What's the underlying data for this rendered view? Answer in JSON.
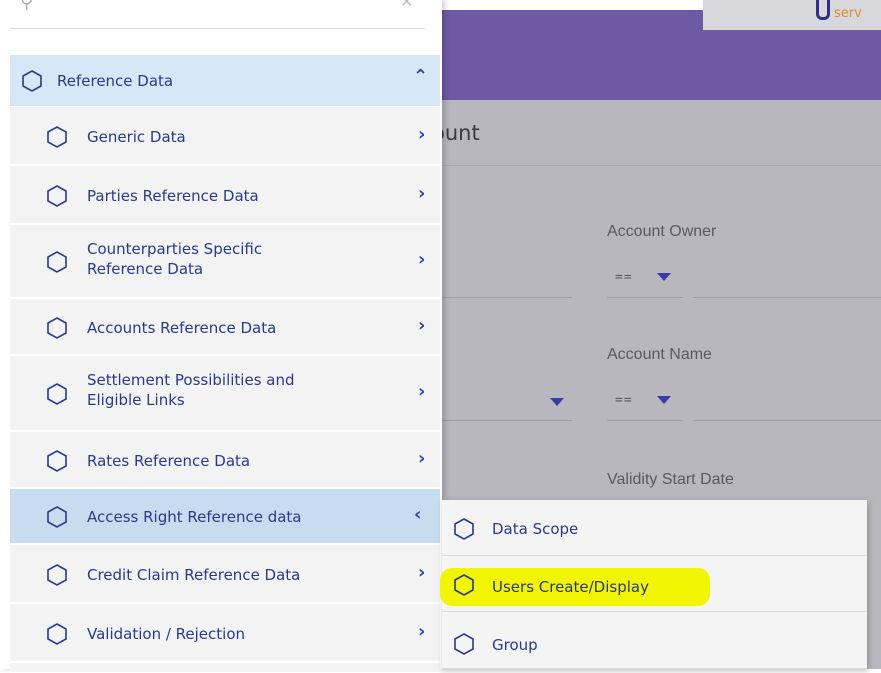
{
  "header": {
    "logo_text": "serv"
  },
  "main": {
    "heading": "ount",
    "fields": [
      {
        "label": "Account Owner",
        "operator": "=="
      },
      {
        "label": "Account Name",
        "operator": "=="
      },
      {
        "label": "Validity Start Date"
      }
    ]
  },
  "menu": {
    "parent": {
      "label": "Reference Data",
      "icon": "hexagon-icon",
      "chevron": "chevron-up-icon"
    },
    "items": [
      {
        "label": "Generic Data"
      },
      {
        "label": "Parties Reference Data"
      },
      {
        "label": "Counterparties Specific\nReference Data"
      },
      {
        "label": "Accounts Reference Data"
      },
      {
        "label": "Settlement Possibilities and\nEligible Links"
      },
      {
        "label": "Rates Reference Data"
      },
      {
        "label": "Access Right Reference data",
        "active": true
      },
      {
        "label": "Credit Claim Reference Data"
      },
      {
        "label": "Validation / Rejection"
      }
    ]
  },
  "submenu": {
    "items": [
      {
        "label": "Data Scope"
      },
      {
        "label": "Users Create/Display",
        "highlighted": true
      },
      {
        "label": "Group"
      }
    ]
  },
  "colors": {
    "purple_bar": "#6e5aa4",
    "menu_text": "#2a3a8a",
    "highlight": "#f2f500",
    "active_item": "#c7dcef"
  }
}
